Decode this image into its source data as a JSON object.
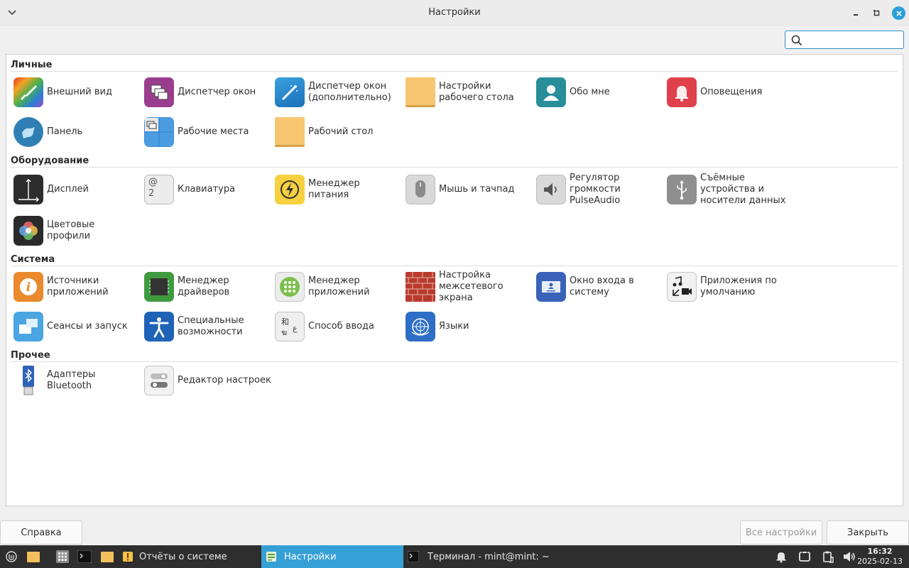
{
  "window": {
    "title": "Настройки"
  },
  "search": {
    "value": "",
    "placeholder": ""
  },
  "sections": [
    {
      "title": "Личные",
      "items": [
        {
          "label": "Внешний вид",
          "icon": "appearance-icon"
        },
        {
          "label": "Диспетчер окон",
          "icon": "window-manager-icon"
        },
        {
          "label": "Диспетчер окон (дополнительно)",
          "icon": "window-manager-tweaks-icon"
        },
        {
          "label": "Настройки рабочего стола",
          "icon": "desktop-settings-icon"
        },
        {
          "label": "Обо мне",
          "icon": "about-me-icon"
        },
        {
          "label": "Оповещения",
          "icon": "notifications-icon"
        },
        {
          "label": "Панель",
          "icon": "panel-icon"
        },
        {
          "label": "Рабочие места",
          "icon": "workspaces-icon"
        },
        {
          "label": "Рабочий стол",
          "icon": "desktop-icon"
        }
      ]
    },
    {
      "title": "Оборудование",
      "items": [
        {
          "label": "Дисплей",
          "icon": "display-icon"
        },
        {
          "label": "Клавиатура",
          "icon": "keyboard-icon"
        },
        {
          "label": "Менеджер питания",
          "icon": "power-manager-icon"
        },
        {
          "label": "Мышь и тачпад",
          "icon": "mouse-icon"
        },
        {
          "label": "Регулятор громкости PulseAudio",
          "icon": "volume-icon"
        },
        {
          "label": "Съёмные устройства и носители данных",
          "icon": "usb-icon"
        },
        {
          "label": "Цветовые профили",
          "icon": "color-profiles-icon"
        }
      ]
    },
    {
      "title": "Система",
      "items": [
        {
          "label": "Источники приложений",
          "icon": "software-sources-icon"
        },
        {
          "label": "Менеджер драйверов",
          "icon": "driver-manager-icon"
        },
        {
          "label": "Менеджер приложений",
          "icon": "software-manager-icon"
        },
        {
          "label": "Настройка межсетевого экрана",
          "icon": "firewall-icon"
        },
        {
          "label": "Окно входа в систему",
          "icon": "login-window-icon"
        },
        {
          "label": "Приложения по умолчанию",
          "icon": "default-apps-icon"
        },
        {
          "label": "Сеансы и запуск",
          "icon": "sessions-icon"
        },
        {
          "label": "Специальные возможности",
          "icon": "accessibility-icon"
        },
        {
          "label": "Способ ввода",
          "icon": "input-method-icon"
        },
        {
          "label": "Языки",
          "icon": "languages-icon"
        }
      ]
    },
    {
      "title": "Прочее",
      "items": [
        {
          "label": "Адаптеры Bluetooth",
          "icon": "bluetooth-icon"
        },
        {
          "label": "Редактор настроек",
          "icon": "settings-editor-icon"
        }
      ]
    }
  ],
  "footer": {
    "help": "Справка",
    "all_settings": "Все настройки",
    "close": "Закрыть"
  },
  "taskbar": {
    "tasks": [
      {
        "label": "Отчёты о системе"
      },
      {
        "label": "Настройки"
      },
      {
        "label": "Терминал - mint@mint: ~"
      }
    ],
    "time": "16:32",
    "date": "2025-02-13"
  },
  "colors": {
    "accent": "#35a0d6",
    "taskbar": "#2e2e2e"
  }
}
